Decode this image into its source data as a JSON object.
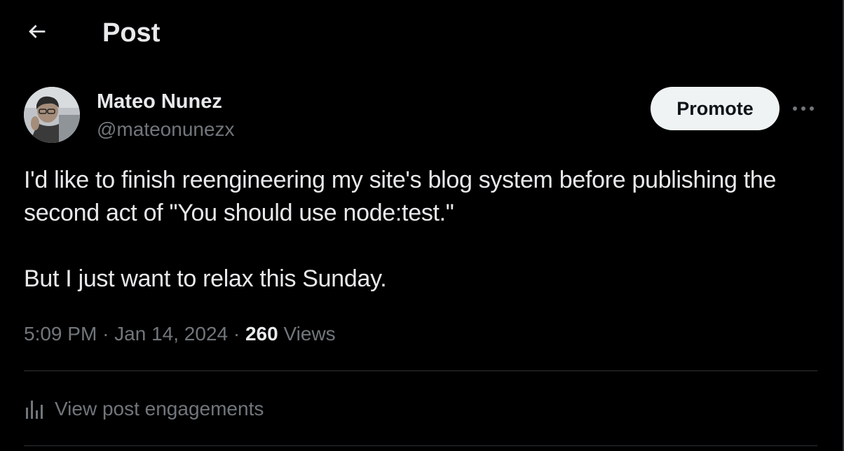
{
  "header": {
    "back_icon": "arrow-left-icon",
    "title": "Post"
  },
  "author": {
    "name": "Mateo Nunez",
    "handle": "@mateonunezx",
    "avatar_icon": "user-avatar-photo"
  },
  "actions": {
    "promote_label": "Promote",
    "more_icon": "more-horizontal-icon"
  },
  "post": {
    "line_1": "I'd like to finish reengineering my site's blog system before publishing the",
    "line_2": "second act of \"You should use node:test.\"",
    "line_3": "But I just want to relax this Sunday."
  },
  "meta": {
    "time": "5:09 PM",
    "separator": "·",
    "date": "Jan 14, 2024",
    "views_count": "260",
    "views_label": "Views"
  },
  "engagements": {
    "icon": "analytics-bar-icon",
    "label": "View post engagements"
  },
  "colors": {
    "background": "#000000",
    "text_primary": "#e7e9ea",
    "text_secondary": "#71767b",
    "divider": "#2f3336",
    "promote_bg": "#eff3f4"
  }
}
